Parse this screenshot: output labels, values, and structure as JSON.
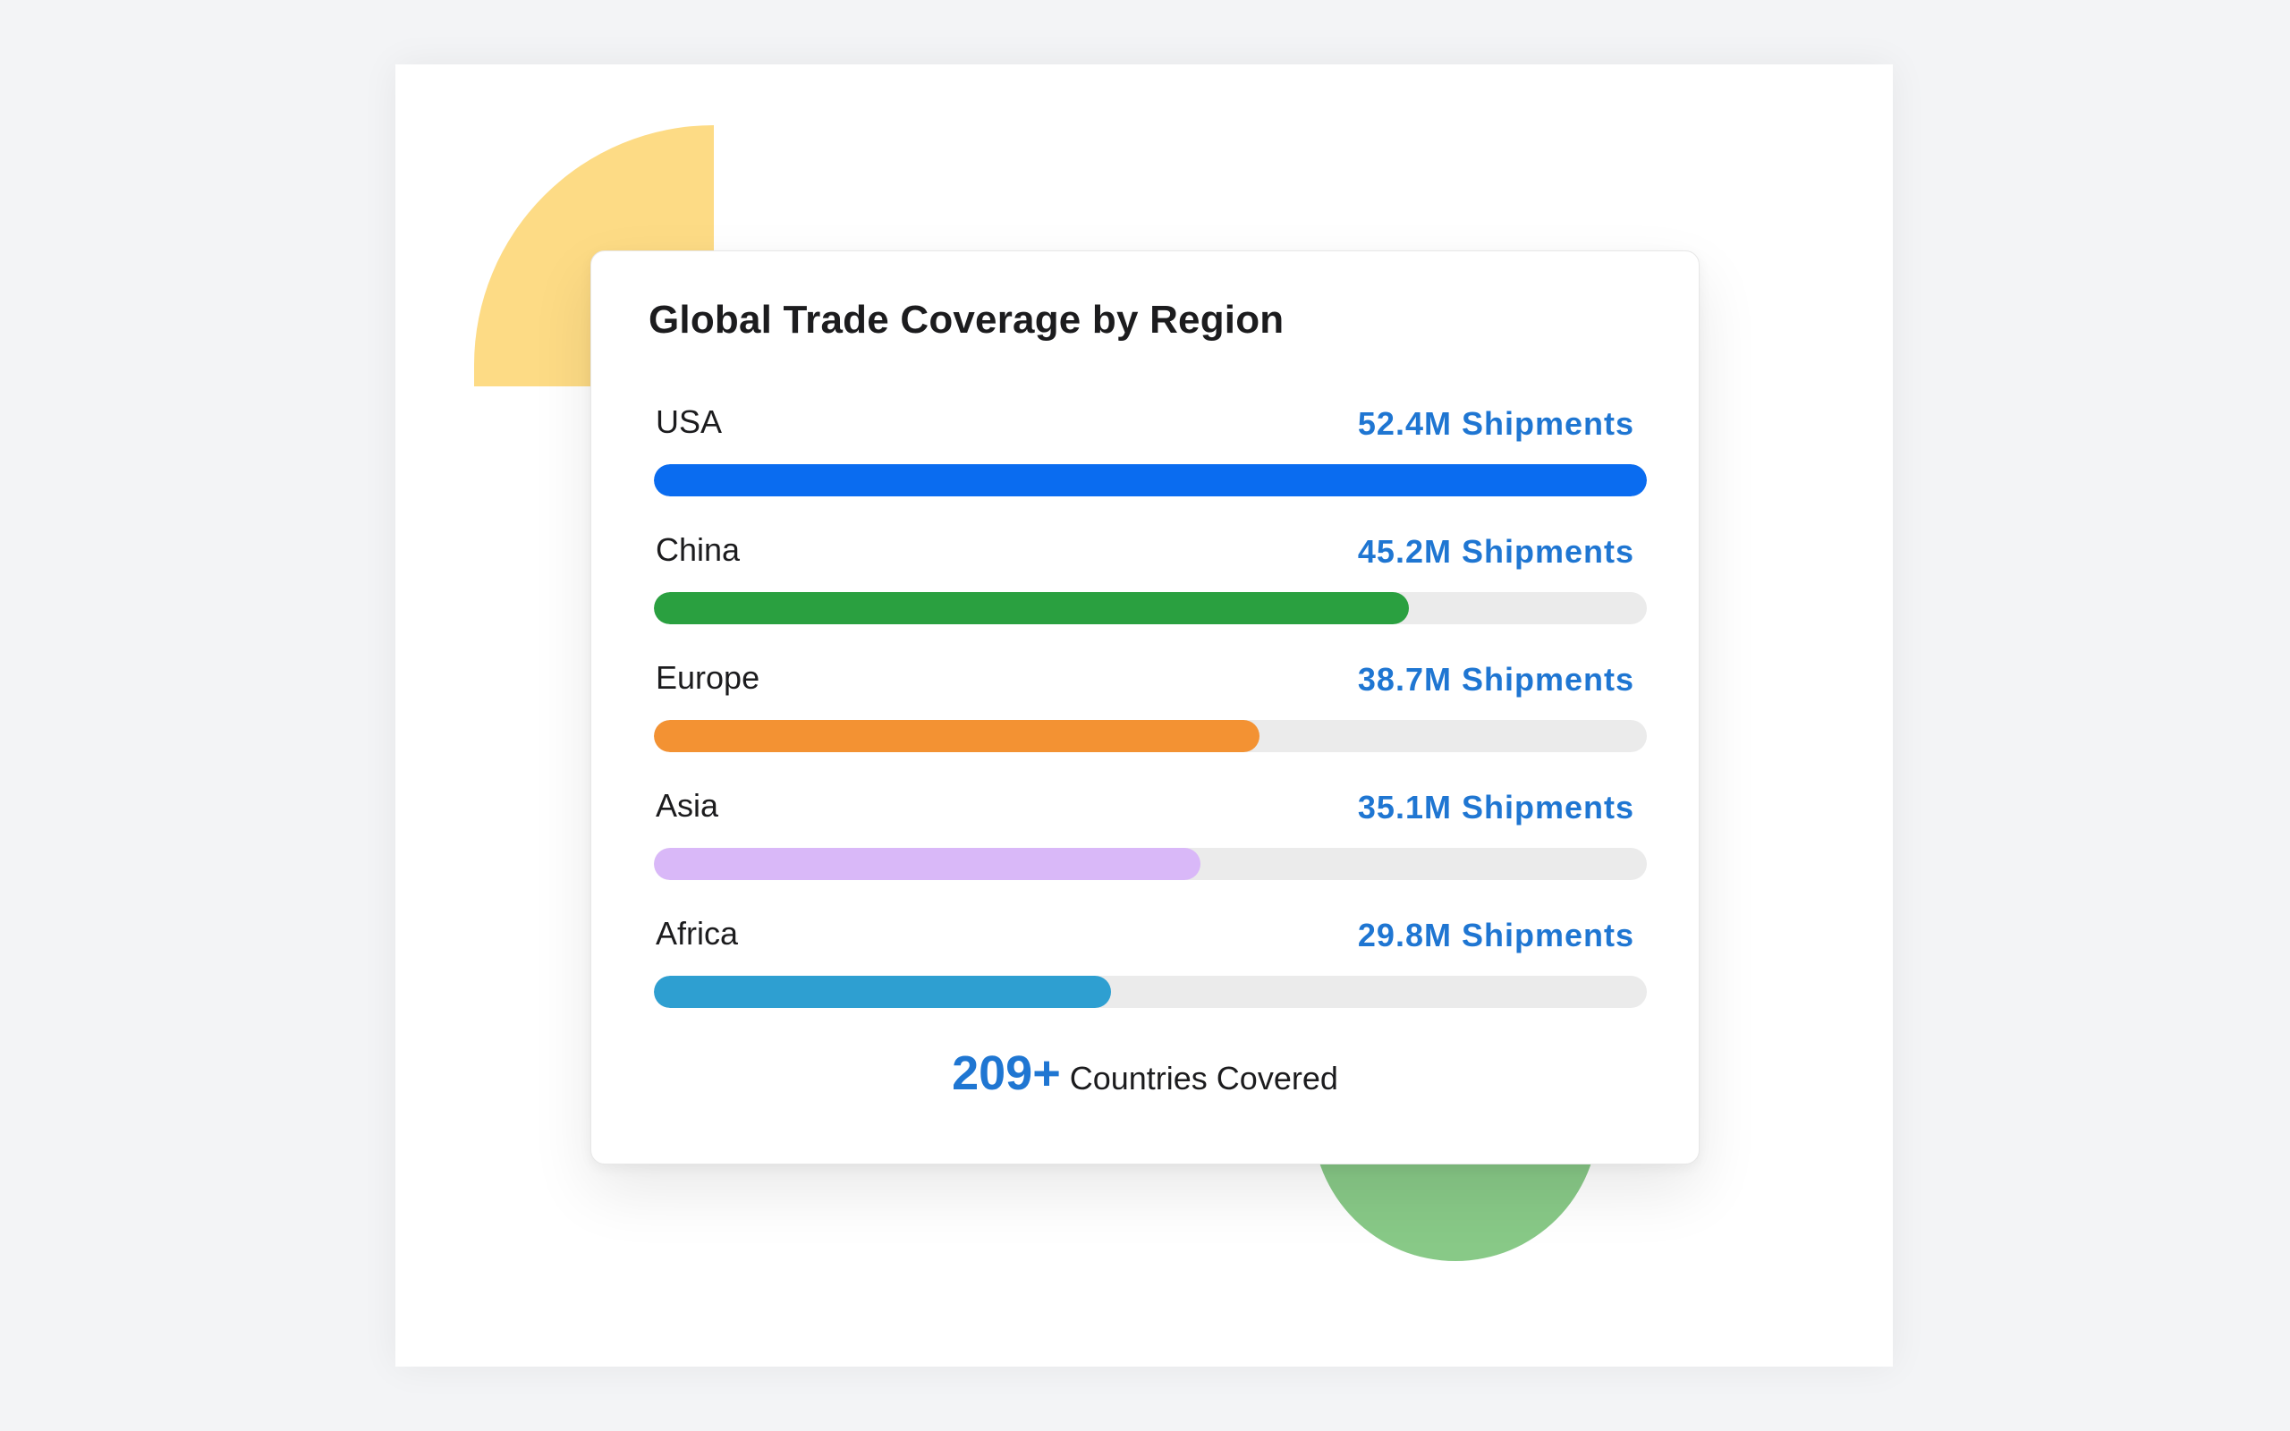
{
  "colors": {
    "value_text": "#1f76d2",
    "track": "#ebebeb",
    "decor_yellow": "#fddb85",
    "decor_green": "#88c987"
  },
  "chart_data": {
    "type": "bar",
    "orientation": "horizontal",
    "title": "Global Trade Coverage by Region",
    "unit": "Shipments",
    "categories": [
      "USA",
      "China",
      "Europe",
      "Asia",
      "Africa"
    ],
    "values": [
      52.4,
      45.2,
      38.7,
      35.1,
      29.8
    ],
    "value_labels": [
      "52.4M Shipments",
      "45.2M Shipments",
      "38.7M Shipments",
      "35.1M Shipments",
      "29.8M Shipments"
    ],
    "fill_fractions": [
      1.0,
      0.76,
      0.61,
      0.55,
      0.46
    ],
    "colors": [
      "#0a6cf0",
      "#2aa040",
      "#f39233",
      "#d9b8f8",
      "#2e9fd1"
    ],
    "grid": false,
    "legend": "none"
  },
  "summary": {
    "number": "209+",
    "text": "Countries Covered"
  }
}
